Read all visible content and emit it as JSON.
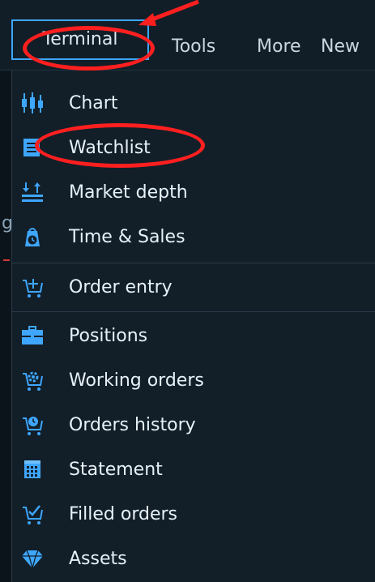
{
  "topbar": {
    "tabs": [
      {
        "label": "Terminal"
      },
      {
        "label": "Tools"
      },
      {
        "label": "More"
      },
      {
        "label": "New"
      }
    ]
  },
  "left_strip": {
    "fragment": "g"
  },
  "menu": {
    "items": [
      {
        "label": "Chart",
        "icon": "candles-icon"
      },
      {
        "label": "Watchlist",
        "icon": "list-icon"
      },
      {
        "label": "Market depth",
        "icon": "depth-icon"
      },
      {
        "label": "Time & Sales",
        "icon": "time-sales-icon"
      },
      {
        "label": "Order entry",
        "icon": "cart-plus-icon"
      },
      {
        "label": "Positions",
        "icon": "briefcase-icon"
      },
      {
        "label": "Working orders",
        "icon": "cart-gear-icon"
      },
      {
        "label": "Orders history",
        "icon": "cart-clock-icon"
      },
      {
        "label": "Statement",
        "icon": "calendar-icon"
      },
      {
        "label": "Filled orders",
        "icon": "cart-check-icon"
      },
      {
        "label": "Assets",
        "icon": "diamond-icon"
      }
    ]
  },
  "colors": {
    "accent": "#3ea6ff",
    "icon": "#3ea6ff",
    "annotation": "#ff1f1f",
    "menu_bg": "#121f29"
  }
}
